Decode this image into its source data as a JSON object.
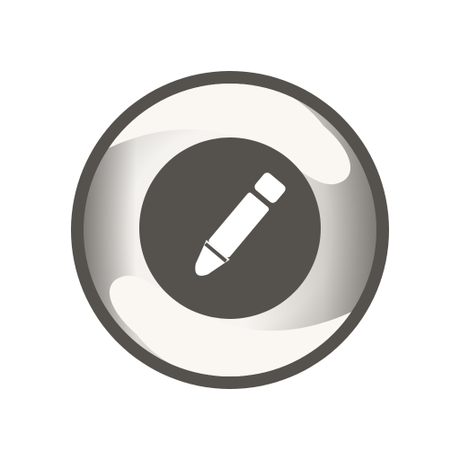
{
  "icon": {
    "name": "pencil-edit-app-icon",
    "colors": {
      "ring": "#55514c",
      "inner_disc": "#55514c",
      "swoosh_light": "#faf7f2",
      "bezel_light": "#f4f2ee",
      "bezel_mid": "#c9c6c1",
      "bezel_dark": "#8f8c87",
      "pencil": "#ffffff",
      "background": "#ffffff"
    }
  }
}
